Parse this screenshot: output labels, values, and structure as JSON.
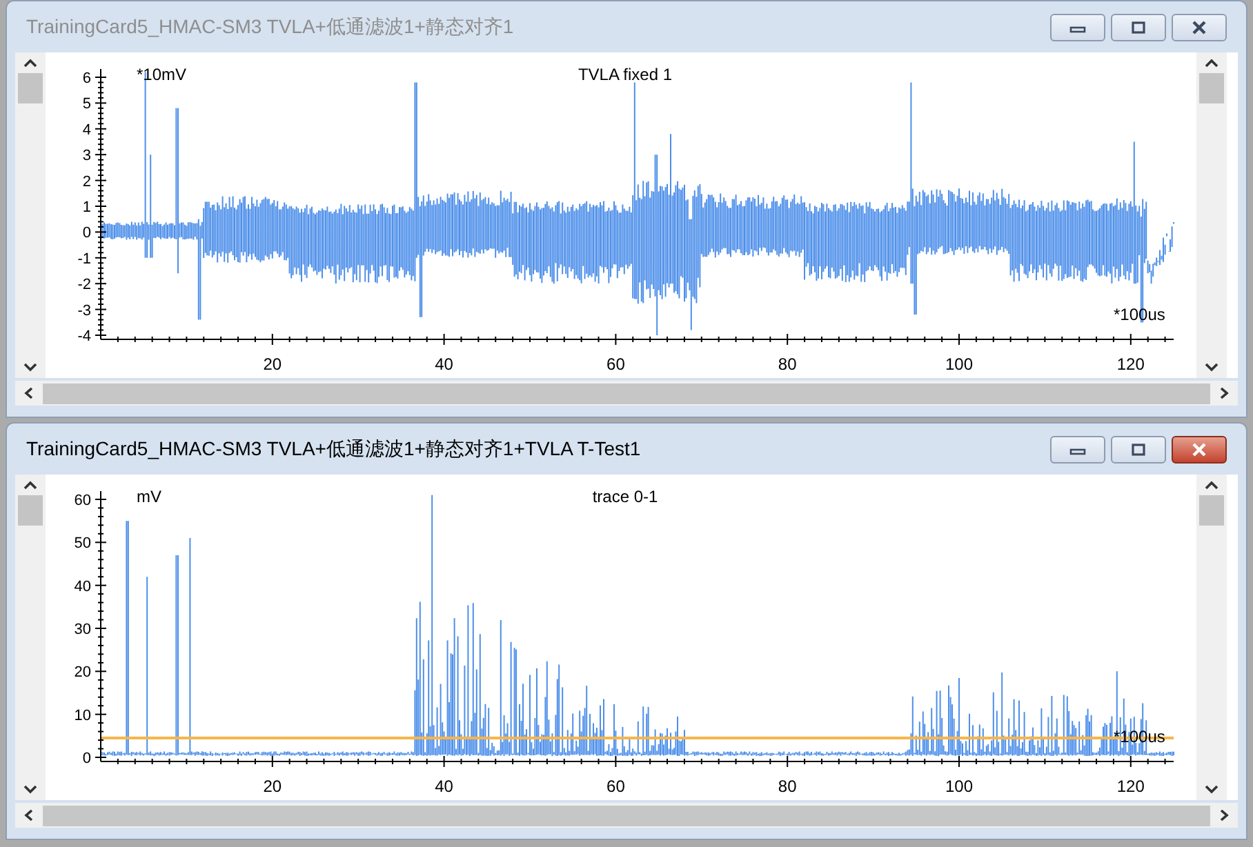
{
  "windows": [
    {
      "title": "TrainingCard5_HMAC-SM3 TVLA+低通滤波1+静态对齐1",
      "active": false,
      "plot": {
        "kind": "tvla",
        "title": "TVLA fixed 1",
        "y_unit": "*10mV",
        "x_unit": "*100us",
        "yticks": [
          "6",
          "5",
          "4",
          "3",
          "2",
          "1",
          "0",
          "-1",
          "-2",
          "-3",
          "-4"
        ],
        "xticks": [
          "20",
          "40",
          "60",
          "80",
          "100",
          "120"
        ]
      }
    },
    {
      "title": "TrainingCard5_HMAC-SM3 TVLA+低通滤波1+静态对齐1+TVLA T-Test1",
      "active": true,
      "plot": {
        "kind": "ttest",
        "title": "trace 0-1",
        "y_unit": "mV",
        "x_unit": "*100us",
        "threshold_line": true,
        "yticks": [
          "60",
          "50",
          "40",
          "30",
          "20",
          "10",
          "0"
        ],
        "xticks": [
          "20",
          "40",
          "60",
          "80",
          "100",
          "120"
        ]
      }
    }
  ]
}
